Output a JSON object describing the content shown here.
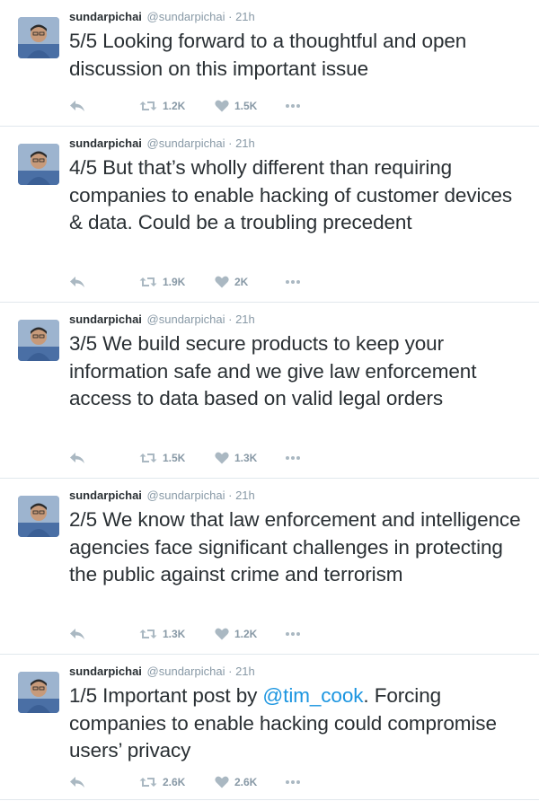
{
  "tweets": [
    {
      "author": "sundarpichai",
      "handle": "@sundarpichai",
      "separator": "·",
      "time": "21h",
      "text": "5/5 Looking forward to a thoughtful and open discussion on this important issue",
      "retweets": "1.2K",
      "likes": "1.5K"
    },
    {
      "author": "sundarpichai",
      "handle": "@sundarpichai",
      "separator": "·",
      "time": "21h",
      "text": "4/5 But that’s wholly different than requiring companies to enable hacking of customer devices & data. Could be a troubling precedent",
      "retweets": "1.9K",
      "likes": "2K"
    },
    {
      "author": "sundarpichai",
      "handle": "@sundarpichai",
      "separator": "·",
      "time": "21h",
      "text": "3/5 We build secure products to keep your information safe and we give law enforcement access to data based on valid legal orders",
      "retweets": "1.5K",
      "likes": "1.3K"
    },
    {
      "author": "sundarpichai",
      "handle": "@sundarpichai",
      "separator": "·",
      "time": "21h",
      "text": "2/5 We know that law enforcement and intelligence agencies face significant challenges in protecting the public against crime and terrorism",
      "retweets": "1.3K",
      "likes": "1.2K"
    },
    {
      "author": "sundarpichai",
      "handle": "@sundarpichai",
      "separator": "·",
      "time": "21h",
      "text_before": "1/5 Important post by ",
      "mention": "@tim_cook",
      "text_after": ". Forcing companies to enable hacking could compromise users’ privacy",
      "retweets": "2.6K",
      "likes": "2.6K"
    }
  ],
  "icons": {
    "reply": "reply-icon",
    "retweet": "retweet-icon",
    "like": "heart-icon",
    "more": "more-icon",
    "avatar": "avatar"
  },
  "colors": {
    "text": "#292f33",
    "secondary": "#8899a6",
    "mention": "#1b95e0",
    "divider": "#e1e8ed"
  }
}
